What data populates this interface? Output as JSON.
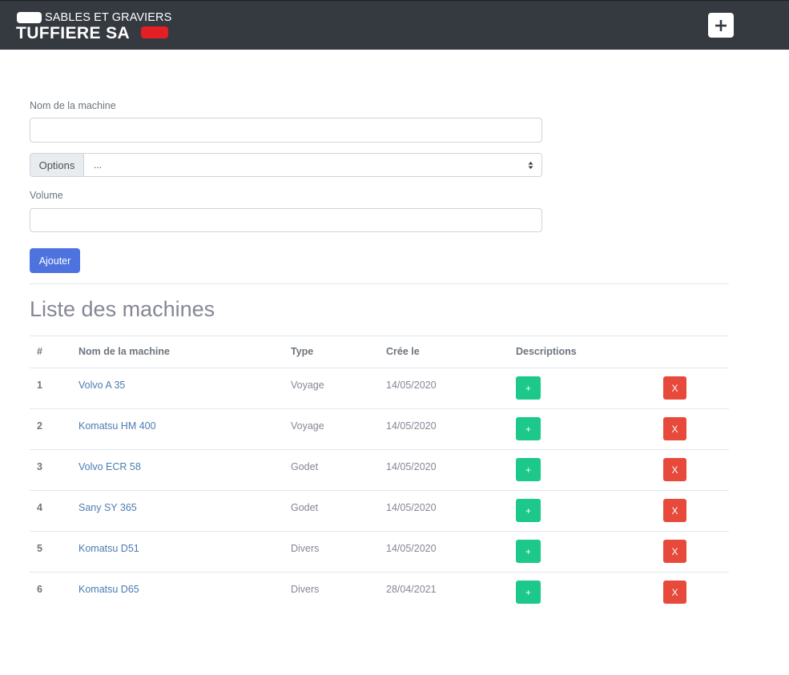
{
  "brand": {
    "line1": "SABLES ET GRAVIERS",
    "line2": "TUFFIERE SA",
    "red": "#e31e24"
  },
  "navbar": {
    "add_icon": "plus-icon",
    "background": "#343a40"
  },
  "form": {
    "name_label": "Nom de la machine",
    "name_value": "",
    "options_prefix": "Options",
    "options_selected": "...",
    "volume_label": "Volume",
    "volume_value": "",
    "submit_label": "Ajouter"
  },
  "list": {
    "title": "Liste des machines",
    "headers": {
      "num": "#",
      "name": "Nom de la machine",
      "type": "Type",
      "date": "Crée le",
      "descriptions": "Descriptions"
    },
    "rows": [
      {
        "num": "1",
        "name": "Volvo A 35",
        "type": "Voyage",
        "date": "14/05/2020",
        "add": "+",
        "delete": "X"
      },
      {
        "num": "2",
        "name": "Komatsu HM 400",
        "type": "Voyage",
        "date": "14/05/2020",
        "add": "+",
        "delete": "X"
      },
      {
        "num": "3",
        "name": "Volvo ECR 58",
        "type": "Godet",
        "date": "14/05/2020",
        "add": "+",
        "delete": "X"
      },
      {
        "num": "4",
        "name": "Sany SY 365",
        "type": "Godet",
        "date": "14/05/2020",
        "add": "+",
        "delete": "X"
      },
      {
        "num": "5",
        "name": "Komatsu D51",
        "type": "Divers",
        "date": "14/05/2020",
        "add": "+",
        "delete": "X"
      },
      {
        "num": "6",
        "name": "Komatsu D65",
        "type": "Divers",
        "date": "28/04/2021",
        "add": "+",
        "delete": "X"
      }
    ]
  },
  "colors": {
    "primary": "#4e73df",
    "success": "#1cc88a",
    "danger": "#e74a3b",
    "link": "#4b7cb3"
  }
}
